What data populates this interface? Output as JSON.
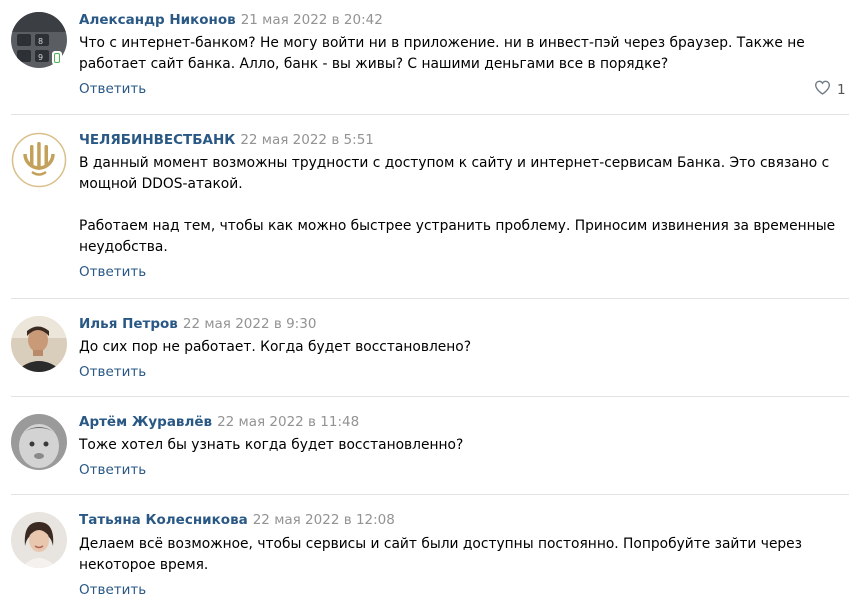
{
  "comments": [
    {
      "author": "Александр Никонов",
      "date": "21 мая 2022 в 20:42",
      "text": "Что с интернет-банком? Не могу войти ни в приложение. ни в инвест-пэй через браузер. Также не работает сайт банка. Алло, банк - вы живы? С нашими деньгами все в порядке?",
      "reply": "Ответить",
      "likes": "1",
      "online_mobile": true
    },
    {
      "author": "ЧЕЛЯБИНВЕСТБАНК",
      "date": "22 мая 2022 в 5:51",
      "text_p1": "В данный момент возможны трудности с доступом к сайту и интернет-сервисам Банка. Это связано с мощной DDOS-атакой.",
      "text_p2": "Работаем над тем, чтобы как можно быстрее устранить проблему. Приносим извинения за временные неудобства.",
      "reply": "Ответить"
    },
    {
      "author": "Илья Петров",
      "date": "22 мая 2022 в 9:30",
      "text": "До сих пор не работает. Когда будет восстановлено?",
      "reply": "Ответить"
    },
    {
      "author": "Артём Журавлёв",
      "date": "22 мая 2022 в 11:48",
      "text": "Тоже хотел бы узнать когда будет восстановленно?",
      "reply": "Ответить"
    },
    {
      "author": "Татьяна Колесникова",
      "date": "22 мая 2022 в 12:08",
      "text": "Делаем всё возможное, чтобы сервисы и сайт были доступны постоянно. Попробуйте зайти через некоторое время.",
      "reply": "Ответить"
    }
  ],
  "colors": {
    "link": "#2a5885",
    "date": "#939393",
    "divider": "#e3e3e3",
    "bank_gold": "#c4a15b",
    "online": "#4bb34b"
  },
  "icons": {
    "like": "heart-outline-icon",
    "online": "mobile-online-icon"
  }
}
